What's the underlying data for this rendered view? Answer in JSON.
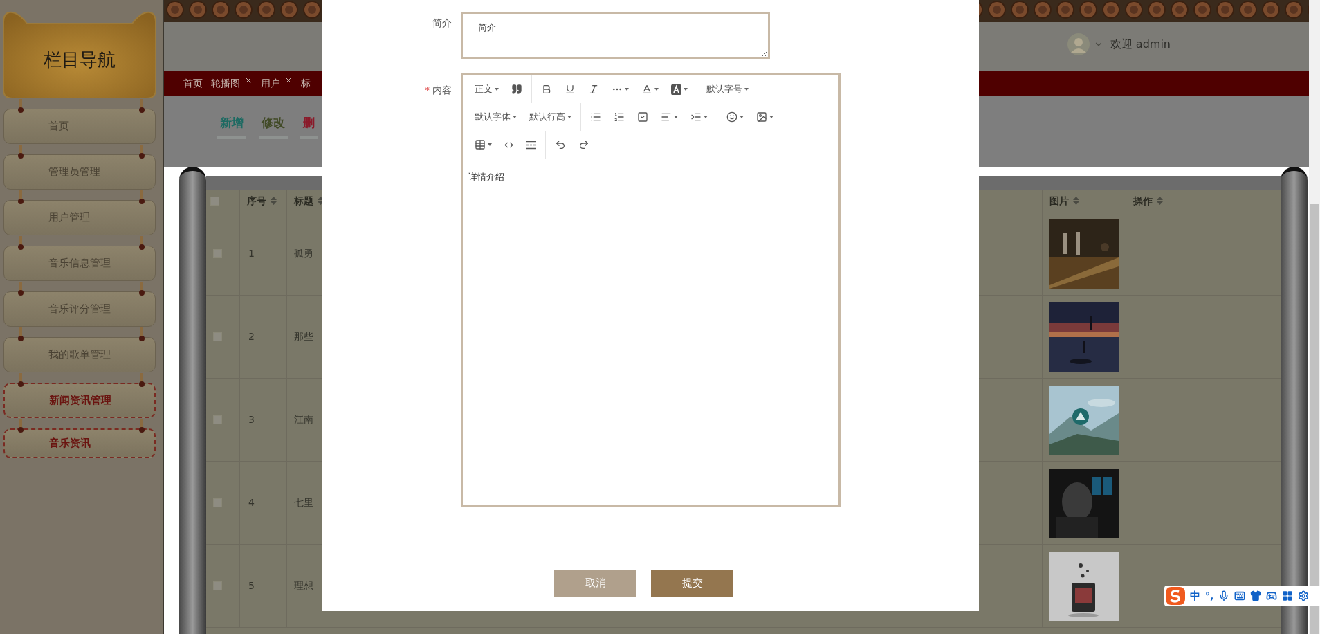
{
  "sidebar": {
    "title": "栏目导航",
    "items": [
      {
        "label": "首页",
        "expanded": false
      },
      {
        "label": "管理员管理",
        "expanded": false
      },
      {
        "label": "用户管理",
        "expanded": false
      },
      {
        "label": "音乐信息管理",
        "expanded": false
      },
      {
        "label": "音乐评分管理",
        "expanded": false
      },
      {
        "label": "我的歌单管理",
        "expanded": false
      },
      {
        "label": "新闻资讯管理",
        "expanded": true,
        "children": [
          {
            "label": "音乐资讯",
            "selected": true
          }
        ]
      }
    ]
  },
  "header": {
    "welcome": "欢迎 admin"
  },
  "tabs": [
    {
      "label": "首页",
      "closable": false
    },
    {
      "label": "轮播图",
      "closable": true
    },
    {
      "label": "用户",
      "closable": true
    },
    {
      "label": "标",
      "closable": false
    }
  ],
  "actions": [
    {
      "label": "新增",
      "color": "#1d6a62"
    },
    {
      "label": "修改",
      "color": "#414a26"
    },
    {
      "label": "删",
      "color": "#8a1a2a"
    }
  ],
  "table": {
    "select_all": {
      "checked": false
    },
    "columns": [
      {
        "label": "序号",
        "sortable": true
      },
      {
        "label": "标题",
        "sortable": true
      },
      {
        "label": "图片",
        "sortable": true
      },
      {
        "label": "操作",
        "sortable": true
      }
    ],
    "rows": [
      {
        "checked": false,
        "index": "1",
        "title": "孤勇"
      },
      {
        "checked": false,
        "index": "2",
        "title": "那些"
      },
      {
        "checked": false,
        "index": "3",
        "title": "江南"
      },
      {
        "checked": false,
        "index": "4",
        "title": "七里"
      },
      {
        "checked": false,
        "index": "5",
        "title": "理想"
      }
    ]
  },
  "dialog": {
    "fields": [
      {
        "kind": "textarea",
        "label": "简介",
        "value": "简介"
      },
      {
        "kind": "editor",
        "label": "内容",
        "required_mark": "*",
        "toolbar": {
          "heading": "正文",
          "font_size": "默认字号",
          "font_family": "默认字体",
          "line_height": "默认行高"
        },
        "value": "详情介绍"
      }
    ],
    "buttons": [
      {
        "label": "取消",
        "kind": "cancel"
      },
      {
        "label": "提交",
        "kind": "submit"
      }
    ]
  },
  "ime_bar": {
    "mode": "中",
    "punctuation": "°,"
  }
}
